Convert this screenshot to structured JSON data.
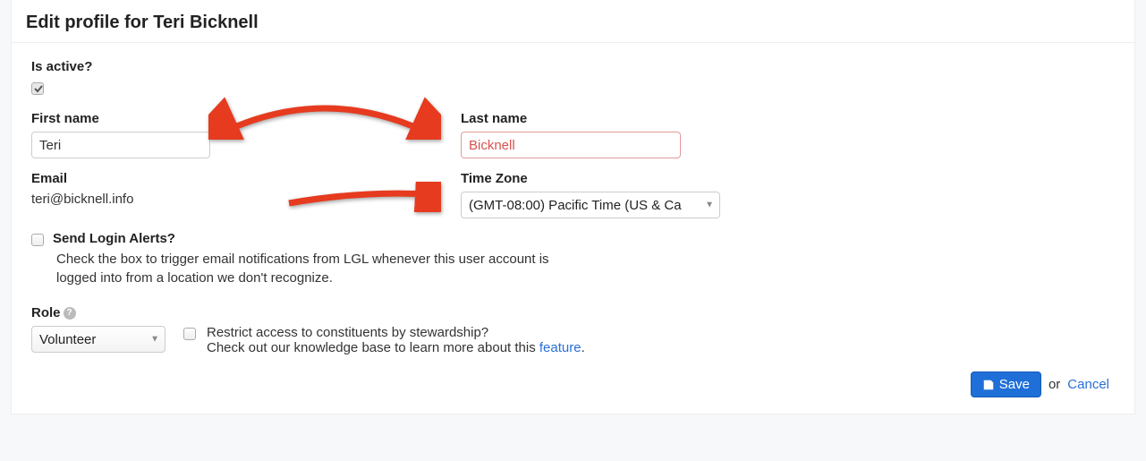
{
  "page_title": "Edit profile for Teri Bicknell",
  "is_active": {
    "label": "Is active?",
    "checked": true
  },
  "first_name": {
    "label": "First name",
    "value": "Teri"
  },
  "last_name": {
    "label": "Last name",
    "value": "Bicknell"
  },
  "email": {
    "label": "Email",
    "value": "teri@bicknell.info"
  },
  "time_zone": {
    "label": "Time Zone",
    "value": "(GMT-08:00) Pacific Time (US & Ca"
  },
  "login_alerts": {
    "label": "Send Login Alerts?",
    "helper": "Check the box to trigger email notifications from LGL whenever this user account is logged into from a location we don't recognize."
  },
  "role": {
    "label": "Role",
    "value": "Volunteer"
  },
  "restrict": {
    "label": "Restrict access to constituents by stewardship?",
    "helper_prefix": "Check out our knowledge base to learn more about this ",
    "link_text": "feature",
    "helper_suffix": "."
  },
  "footer": {
    "save": "Save",
    "or": "or",
    "cancel": "Cancel"
  }
}
